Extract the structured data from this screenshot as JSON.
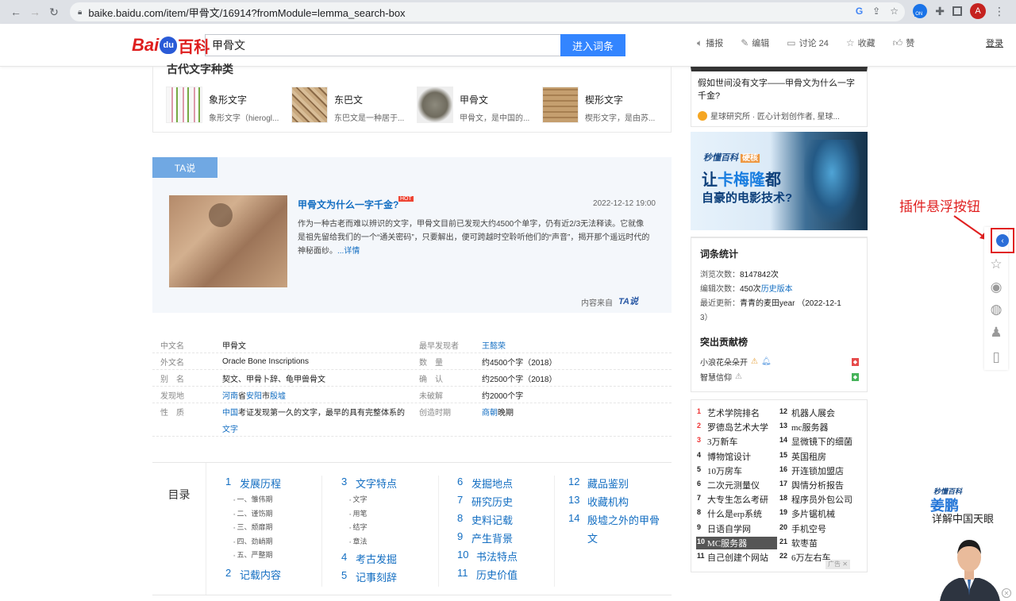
{
  "browser": {
    "url": "baike.baidu.com/item/甲骨文/16914?fromModule=lemma_search-box",
    "avatar_letter": "A",
    "ext_badge": "ON"
  },
  "header": {
    "logo_left": "Bai",
    "logo_paw": "du",
    "logo_right": "百科",
    "search_value": "甲骨文",
    "search_button": "进入词条",
    "tools": [
      "播报",
      "编辑",
      "讨论 24",
      "收藏",
      "赞"
    ],
    "login": "登录"
  },
  "ancient": {
    "title": "古代文字种类",
    "items": [
      {
        "name": "象形文字",
        "desc": "象形文字（hierogl..."
      },
      {
        "name": "东巴文",
        "desc": "东巴文是一种居于..."
      },
      {
        "name": "甲骨文",
        "desc": "甲骨文，是中国的..."
      },
      {
        "name": "楔形文字",
        "desc": "楔形文字，是由苏..."
      }
    ]
  },
  "ta": {
    "tab": "TA说",
    "title": "甲骨文为什么一字千金?",
    "hot": "HOT",
    "date": "2022-12-12 19:00",
    "text": "作为一种古老而难以辨识的文字，甲骨文目前已发现大约4500个单字，仍有近2/3无法释读。它就像是祖先留给我们的一个“通关密码”，只要解出，便可跨越时空聆听他们的“声音”，揭开那个遥远时代的神秘面纱。",
    "more": "...详情",
    "source": "内容来自",
    "source_logo": "TA说"
  },
  "info": [
    {
      "k1": "中文名",
      "v1": "甲骨文",
      "k2": "最早发现者",
      "v2": "王懿荣"
    },
    {
      "k1": "外文名",
      "v1": "Oracle Bone Inscriptions",
      "k2": "数　量",
      "v2": "约4500个字（2018）"
    },
    {
      "k1": "别　名",
      "v1": "契文、甲骨卜辞、龟甲兽骨文",
      "k2": "确　认",
      "v2": "约2500个字（2018）"
    },
    {
      "k1": "发现地",
      "v1a": "河南",
      "v1b": "省",
      "v1c": "安阳",
      "v1d": "市",
      "v1e": "殷墟",
      "k2": "未破解",
      "v2": "约2000个字"
    },
    {
      "k1": "性　质",
      "v1a": "中国",
      "v1b": "考证发现第一久的文字，最早的具有完整体系的",
      "k2": "创造时期",
      "v2a": "商朝",
      "v2b": "晚期"
    },
    {
      "v1a": "文字"
    }
  ],
  "catalog": {
    "label": "目录",
    "col1": [
      {
        "num": "1",
        "title": "发展历程"
      },
      {
        "sub": "一、雏伟期"
      },
      {
        "sub": "二、谨饬期"
      },
      {
        "sub": "三、颓靡期"
      },
      {
        "sub": "四、劲峭期"
      },
      {
        "sub": "五、严整期"
      },
      {
        "num": "2",
        "title": "记载内容"
      }
    ],
    "col2": [
      {
        "num": "3",
        "title": "文字特点"
      },
      {
        "sub": "文字"
      },
      {
        "sub": "用笔"
      },
      {
        "sub": "结字"
      },
      {
        "sub": "章法"
      },
      {
        "num": "4",
        "title": "考古发掘"
      },
      {
        "num": "5",
        "title": "记事刻辞"
      }
    ],
    "col3": [
      {
        "num": "6",
        "title": "发掘地点"
      },
      {
        "num": "7",
        "title": "研究历史"
      },
      {
        "num": "8",
        "title": "史料记载"
      },
      {
        "num": "9",
        "title": "产生背景"
      },
      {
        "num": "10",
        "title": "书法特点"
      },
      {
        "num": "11",
        "title": "历史价值"
      }
    ],
    "col4": [
      {
        "num": "12",
        "title": "藏品鉴别"
      },
      {
        "num": "13",
        "title": "收藏机构"
      },
      {
        "num": "14",
        "title": "殷墟之外的甲骨"
      },
      {
        "num": "",
        "title": "文"
      }
    ]
  },
  "sidebar": {
    "top_title": "假如世间没有文字——甲骨文为什么一字千金?",
    "top_meta": "星球研究所 · 匠心计划创作者, 星球...",
    "ad": {
      "small": "秒懂百科",
      "tag": "硬核",
      "line1a": "让",
      "line1b": "卡梅隆",
      "line1c": "都",
      "line2": "自豪的电影技术?"
    },
    "stats_title": "词条统计",
    "views_label": "浏览次数：",
    "views": "8147842次",
    "edits_label": "编辑次数：",
    "edits": "450次",
    "history": "历史版本",
    "updated_label": "最近更新：",
    "updated": "青青的麦田year （2022-12-1",
    "updated2": "3）",
    "contrib_title": "突出贡献榜",
    "contributors": [
      "小浪花朵朵开",
      "智慧信仰"
    ],
    "hot": [
      {
        "n": "1",
        "t": "艺术学院排名"
      },
      {
        "n": "12",
        "t": "机器人展会"
      },
      {
        "n": "2",
        "t": "罗德岛艺术大学"
      },
      {
        "n": "13",
        "t": "mc服务器"
      },
      {
        "n": "3",
        "t": "3万新车"
      },
      {
        "n": "14",
        "t": "显微镜下的细菌"
      },
      {
        "n": "4",
        "t": "博物馆设计"
      },
      {
        "n": "15",
        "t": "英国租房"
      },
      {
        "n": "5",
        "t": "10万房车"
      },
      {
        "n": "16",
        "t": "开连锁加盟店"
      },
      {
        "n": "6",
        "t": "二次元测量仪"
      },
      {
        "n": "17",
        "t": "舆情分析报告"
      },
      {
        "n": "7",
        "t": "大专生怎么考研"
      },
      {
        "n": "18",
        "t": "程序员外包公司"
      },
      {
        "n": "8",
        "t": "什么是erp系统"
      },
      {
        "n": "19",
        "t": "多片锯机械"
      },
      {
        "n": "9",
        "t": "日语自学网"
      },
      {
        "n": "20",
        "t": "手机空号"
      },
      {
        "n": "10",
        "t": "MC服务器"
      },
      {
        "n": "21",
        "t": "软枣苗"
      },
      {
        "n": "11",
        "t": "自己创建个网站"
      },
      {
        "n": "22",
        "t": "6万左右车"
      }
    ],
    "ad_tag": "广告"
  },
  "floating": {
    "label": "插件悬浮按钮"
  },
  "promo": {
    "logo": "秒懂百科",
    "name": "姜鹏",
    "slogan": "详解中国天眼"
  }
}
